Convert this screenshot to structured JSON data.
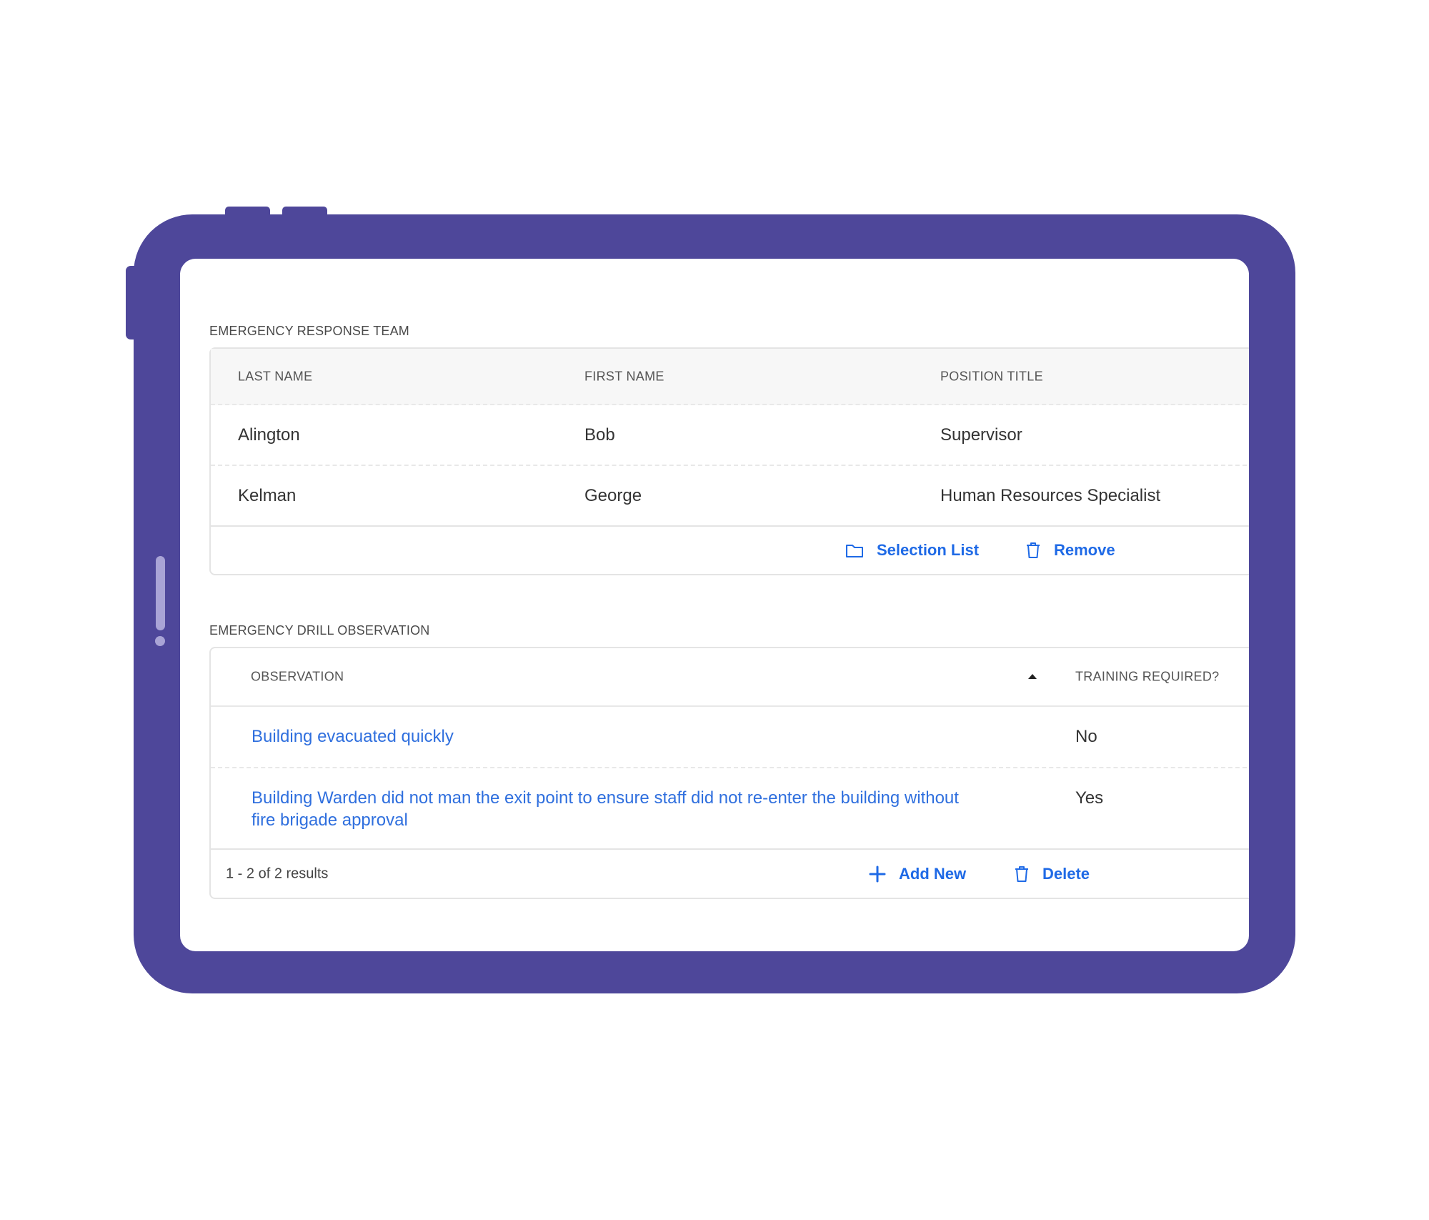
{
  "emergency_response_team": {
    "title": "EMERGENCY RESPONSE TEAM",
    "columns": [
      "LAST NAME",
      "FIRST NAME",
      "POSITION TITLE"
    ],
    "rows": [
      {
        "last_name": "Alington",
        "first_name": "Bob",
        "position_title": "Supervisor"
      },
      {
        "last_name": "Kelman",
        "first_name": "George",
        "position_title": "Human Resources Specialist"
      }
    ],
    "actions": {
      "selection_list": "Selection List",
      "remove": "Remove"
    }
  },
  "emergency_drill_observation": {
    "title": "EMERGENCY DRILL OBSERVATION",
    "columns": [
      "OBSERVATION",
      "TRAINING REQUIRED?"
    ],
    "sort_indicator": "ascending",
    "rows": [
      {
        "observation": "Building evacuated quickly",
        "training_required": "No"
      },
      {
        "observation_line1": "Building Warden did not man the exit point to ensure staff did not re-enter the building without",
        "observation_line2": "fire brigade approval",
        "training_required": "Yes"
      }
    ],
    "results_count": "1 - 2 of 2 results",
    "actions": {
      "add_new": "Add New",
      "delete": "Delete"
    }
  },
  "colors": {
    "device_frame": "#4e479a",
    "link": "#2f6fde",
    "action": "#1f6ae6"
  },
  "icons": [
    "folder-icon",
    "trash-icon",
    "plus-icon",
    "sort-asc-icon"
  ]
}
